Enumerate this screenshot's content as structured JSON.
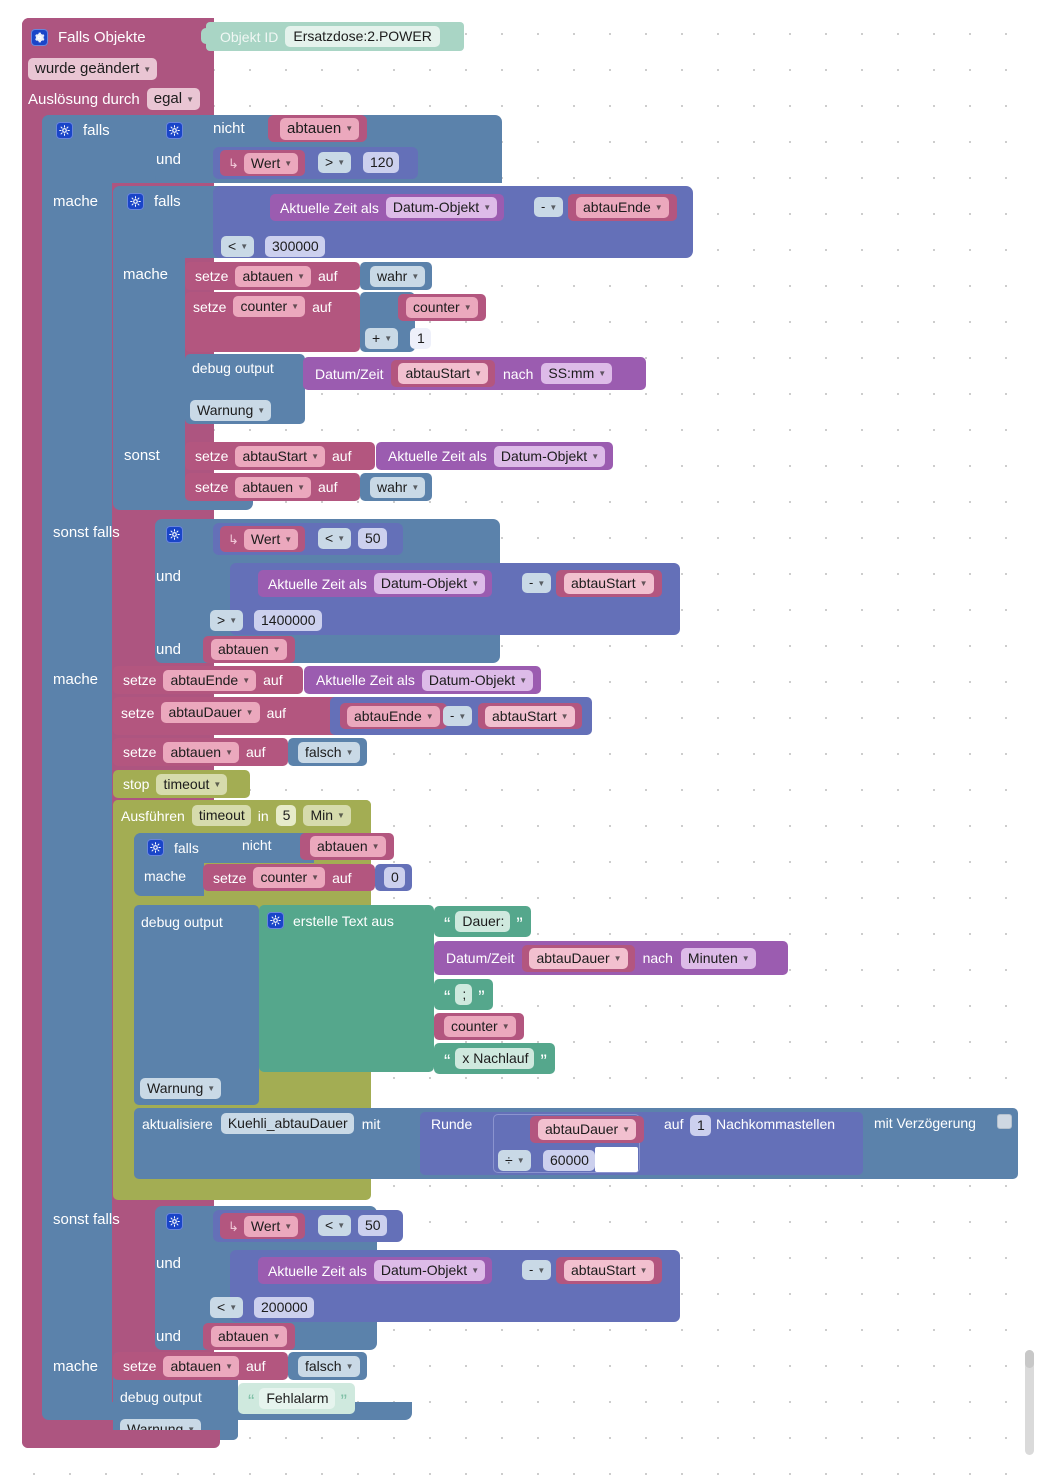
{
  "colors": {
    "event_pink": "#ad5580",
    "control_blue": "#5b82ab",
    "variable_pink": "#b3567f",
    "variable_field": "#eba8bd",
    "math_violet": "#6470b8",
    "math_field": "#ccd0ee",
    "logic_field": "#c9d9e6",
    "date_purple": "#9b5cb0",
    "date_field": "#ddbbe8",
    "text_green": "#55a78c",
    "text_field": "#cfe9de",
    "timeout_olive": "#a3ad53",
    "timeout_field": "#d6dbac",
    "objectid_mint": "#a9d5c5",
    "objectid_field": "#e4f2ec",
    "gear_blue": "#1a45c8"
  },
  "event": {
    "title": "Falls Objekte",
    "object_id_label": "Objekt ID",
    "object_id_value": "Ersatzdose:2.POWER",
    "change_mode": "wurde geändert",
    "trigger_label": "Auslösung durch",
    "trigger_value": "egal"
  },
  "labels": {
    "falls": "falls",
    "mache": "mache",
    "sonst": "sonst",
    "sonst_falls": "sonst falls",
    "und": "und",
    "nicht": "nicht",
    "setze": "setze",
    "auf": "auf",
    "debug_output": "debug output",
    "stop": "stop",
    "ausfuehren": "Ausführen",
    "in": "in",
    "erstelle_text_aus": "erstelle Text aus",
    "aktualisiere": "aktualisiere",
    "mit": "mit",
    "runde": "Runde",
    "nachkommastellen": "Nachkommastellen",
    "mit_verzoegerung": "mit Verzögerung",
    "aktuelle_zeit_als": "Aktuelle Zeit als",
    "datum_zeit": "Datum/Zeit",
    "nach": "nach",
    "wert_arrow": "↳"
  },
  "branch1": {
    "cond_not_var": "abtauen",
    "cond_wert": "Wert",
    "cond_op": ">",
    "cond_num": "120",
    "inner_date_label": "Aktuelle Zeit als",
    "inner_date_field": "Datum-Objekt",
    "inner_minus": "-",
    "inner_var": "abtauEnde",
    "inner_cmp_op": "<",
    "inner_cmp_num": "300000",
    "do_set1_var": "abtauen",
    "do_set1_val": "wahr",
    "do_set2_var": "counter",
    "do_set2_a": "counter",
    "do_set2_op": "+",
    "do_set2_b": "1",
    "debug_datetime_var": "abtauStart",
    "debug_format": "SS:mm",
    "debug_level": "Warnung",
    "else_set1_var": "abtauStart",
    "else_set1_date_label": "Aktuelle Zeit als",
    "else_set1_date_field": "Datum-Objekt",
    "else_set2_var": "abtauen",
    "else_set2_val": "wahr"
  },
  "branch2": {
    "cond_wert": "Wert",
    "cond_op": "<",
    "cond_num": "50",
    "cond2_date_label": "Aktuelle Zeit als",
    "cond2_date_field": "Datum-Objekt",
    "cond2_minus": "-",
    "cond2_var": "abtauStart",
    "cond2_op": ">",
    "cond2_num": "1400000",
    "cond3_var": "abtauen",
    "set1_var": "abtauEnde",
    "set1_date_label": "Aktuelle Zeit als",
    "set1_date_field": "Datum-Objekt",
    "set2_var": "abtauDauer",
    "set2_a": "abtauEnde",
    "set2_op": "-",
    "set2_b": "abtauStart",
    "set3_var": "abtauen",
    "set3_val": "falsch",
    "stop_name": "timeout",
    "run_name": "timeout",
    "run_num": "5",
    "run_unit": "Min",
    "t_if_not_var": "abtauen",
    "t_set_var": "counter",
    "t_set_val": "0",
    "text_1": "Dauer:",
    "text_dt_var": "abtauDauer",
    "text_dt_format": "Minuten",
    "text_2": ";",
    "text_var": "counter",
    "text_3": "x Nachlauf",
    "debug_level": "Warnung",
    "update_target": "Kuehli_abtauDauer",
    "round_var": "abtauDauer",
    "round_op": "÷",
    "round_num": "60000",
    "round_digits": "1"
  },
  "branch3": {
    "cond_wert": "Wert",
    "cond_op": "<",
    "cond_num": "50",
    "cond2_date_label": "Aktuelle Zeit als",
    "cond2_date_field": "Datum-Objekt",
    "cond2_minus": "-",
    "cond2_var": "abtauStart",
    "cond2_op": "<",
    "cond2_num": "200000",
    "cond3_var": "abtauen",
    "set1_var": "abtauen",
    "set1_val": "falsch",
    "debug_text": "Fehlalarm",
    "debug_level": "Warnung"
  }
}
